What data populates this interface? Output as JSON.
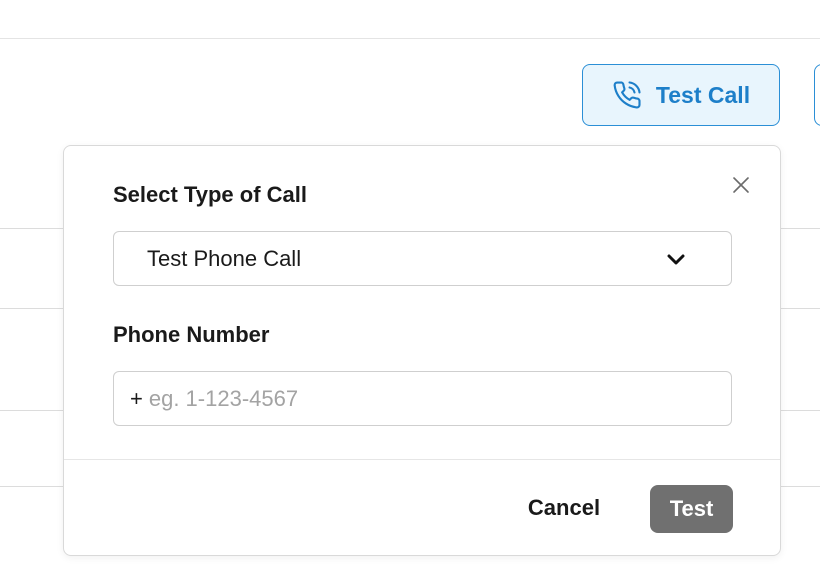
{
  "toolbar": {
    "test_call_label": "Test Call"
  },
  "modal": {
    "call_type_label": "Select Type of Call",
    "call_type_selected": "Test Phone Call",
    "phone_label": "Phone Number",
    "phone_prefix": "+",
    "phone_value": "",
    "phone_placeholder": "eg. 1-123-4567",
    "cancel_label": "Cancel",
    "test_label": "Test"
  },
  "icons": {
    "test_call": "phone-ringing-icon",
    "close": "close-icon",
    "dropdown": "chevron-down-icon"
  },
  "colors": {
    "accent": "#1d7fc9",
    "accent_bg": "#e8f5fd",
    "disabled_button": "#707070"
  }
}
